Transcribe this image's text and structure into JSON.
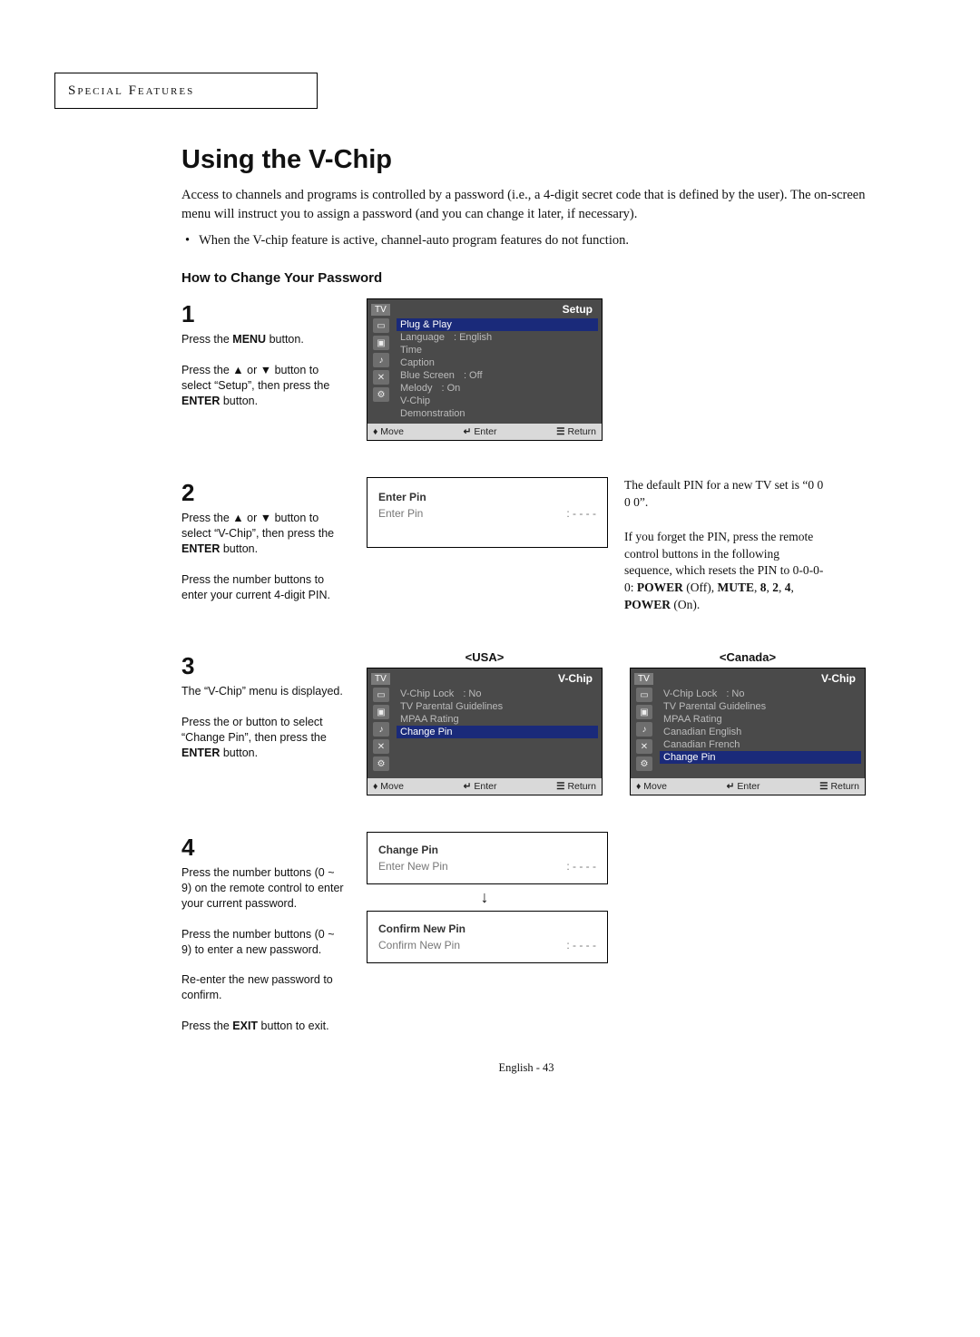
{
  "header": {
    "section_title": "Special Features"
  },
  "title": "Using the V-Chip",
  "intro": "Access to channels and programs is controlled by a password (i.e., a 4-digit secret code that is defined by the user). The on-screen menu will instruct you to assign a password (and you can change it later, if necessary).",
  "bullet": "When the V-chip feature is active, channel-auto program features do not function.",
  "subhead": "How to Change Your Password",
  "steps": {
    "s1": {
      "num": "1",
      "line1_a": "Press the ",
      "line1_b": "MENU",
      "line1_c": " button.",
      "line2_a": "Press the ",
      "line2_b": " or ",
      "line2_c": " button to select “Setup”, then press the ",
      "line2_d": "ENTER",
      "line2_e": " button."
    },
    "s2": {
      "num": "2",
      "line1_a": "Press the ",
      "line1_b": " or ",
      "line1_c": " button to select  “V-Chip”, then press the ",
      "line1_d": "ENTER",
      "line1_e": " button.",
      "line2": "Press the number buttons to enter your current 4-digit PIN.",
      "note_a": "The default PIN for a new TV set is “0 0 0 0”.",
      "note_b_pre": "If you forget the PIN, press the remote control buttons in the following sequence, which resets the PIN to 0-0-0-0: ",
      "note_b_seq": "POWER (Off), MUTE, 8, 2, 4, POWER (On)."
    },
    "s3": {
      "num": "3",
      "line1": "The “V-Chip” menu is displayed.",
      "line2_a": "Press the      or      button to select “Change Pin”, then press the ",
      "line2_b": "ENTER",
      "line2_c": " button."
    },
    "s4": {
      "num": "4",
      "p1": "Press the number buttons (0 ~ 9) on the remote control to enter your current password.",
      "p2": "Press the number buttons (0 ~ 9) to enter a new password.",
      "p3": "Re-enter the new password to confirm.",
      "p4_a": "Press the ",
      "p4_b": "EXIT",
      "p4_c": " button to exit."
    }
  },
  "osd_setup": {
    "tv_label": "TV",
    "title": "Setup",
    "items": [
      {
        "label": "Plug & Play",
        "sel": true
      },
      {
        "label": "Language",
        "val": ": English"
      },
      {
        "label": "Time"
      },
      {
        "label": "Caption"
      },
      {
        "label": "Blue Screen",
        "val": ": Off"
      },
      {
        "label": "Melody",
        "val": ": On"
      },
      {
        "label": "V-Chip"
      },
      {
        "label": "Demonstration"
      }
    ]
  },
  "osd_footer": {
    "move": "Move",
    "enter": "Enter",
    "return": "Return"
  },
  "dlg_enterpin": {
    "title": "Enter Pin",
    "row_label": "Enter Pin",
    "row_val": ": - - - -"
  },
  "osd_vchip_labels": {
    "usa": "<USA>",
    "canada": "<Canada>"
  },
  "osd_vchip_usa": {
    "tv_label": "TV",
    "title": "V-Chip",
    "items": [
      {
        "label": "V-Chip Lock",
        "val": ":  No"
      },
      {
        "label": "TV Parental Guidelines"
      },
      {
        "label": "MPAA Rating"
      },
      {
        "label": "Change Pin",
        "sel": true
      }
    ]
  },
  "osd_vchip_ca": {
    "tv_label": "TV",
    "title": "V-Chip",
    "items": [
      {
        "label": "V-Chip Lock",
        "val": ":  No"
      },
      {
        "label": "TV Parental Guidelines"
      },
      {
        "label": "MPAA Rating"
      },
      {
        "label": "Canadian English"
      },
      {
        "label": "Canadian French"
      },
      {
        "label": "Change Pin",
        "sel": true
      }
    ]
  },
  "dlg_changepin": {
    "title": "Change Pin",
    "row_label": "Enter New Pin",
    "row_val": ": - - - -"
  },
  "dlg_confirmpin": {
    "title": "Confirm New Pin",
    "row_label": "Confirm New Pin",
    "row_val": ": - - - -"
  },
  "icons": {
    "up": "▲",
    "down": "▼",
    "updown": "♦",
    "enter_icon": "↵",
    "return_icon": "☰",
    "arrow_down": "↓"
  },
  "footer": "English - 43"
}
